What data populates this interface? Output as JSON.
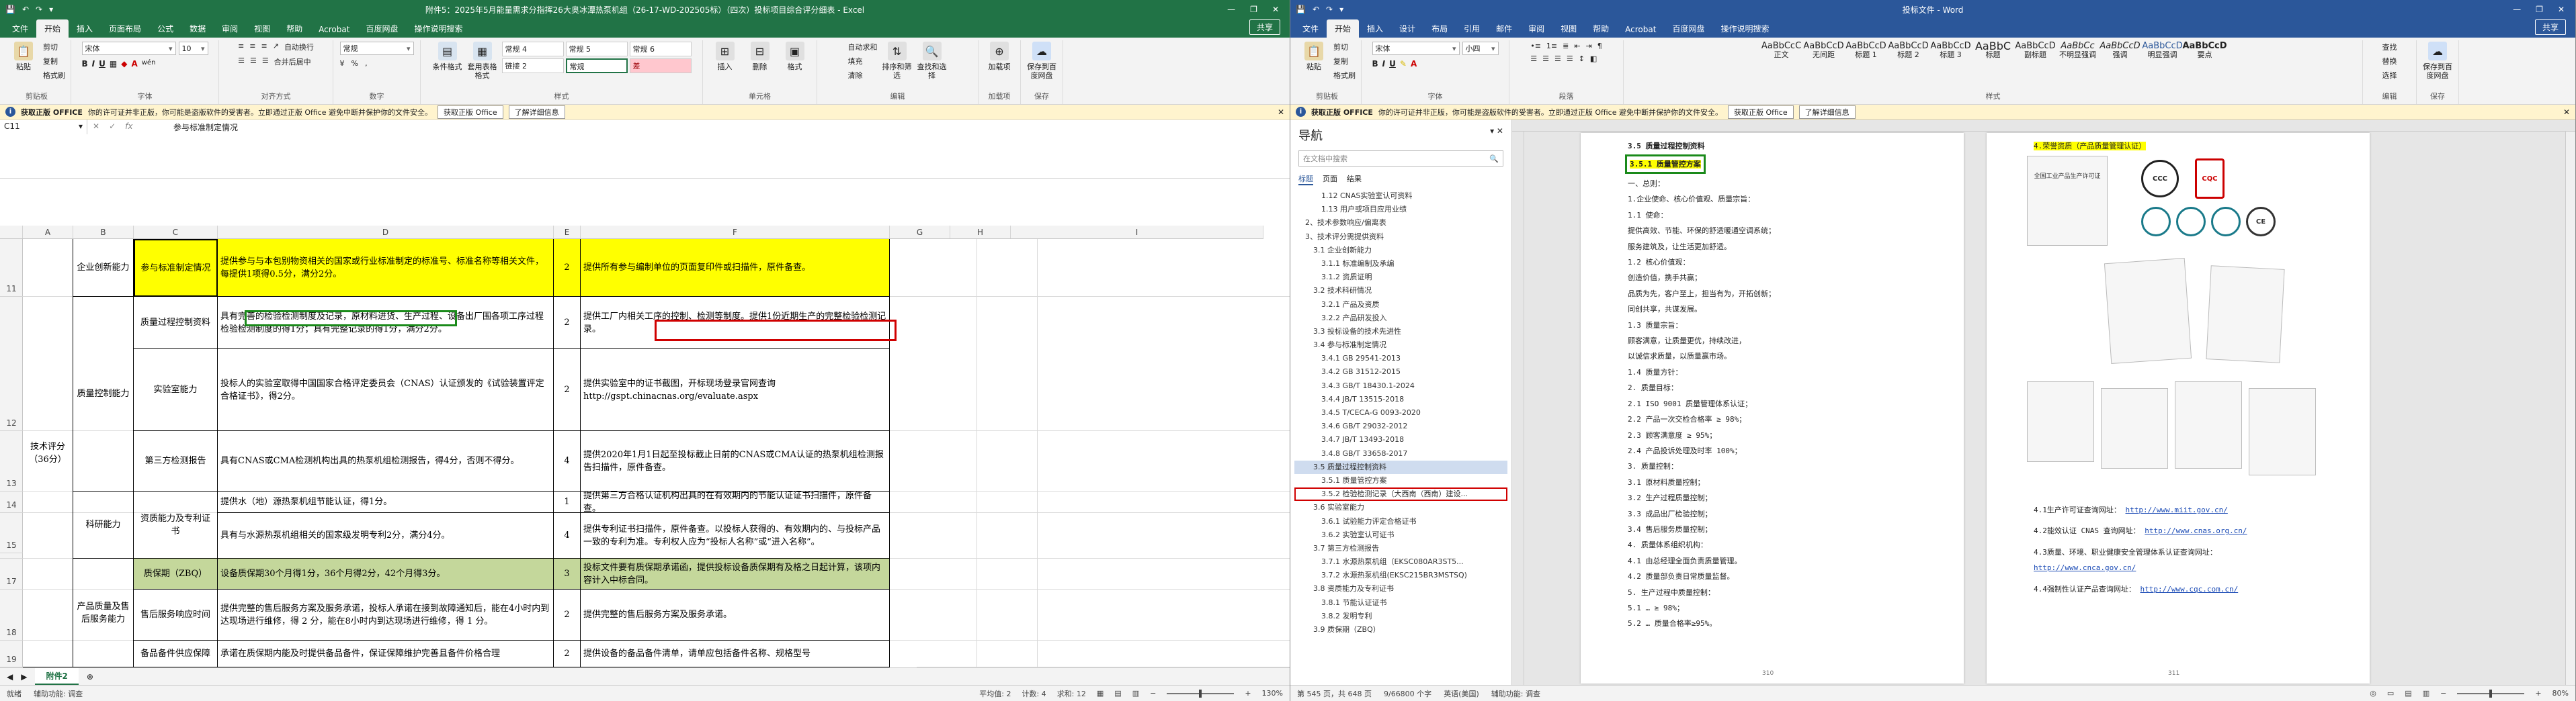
{
  "excel": {
    "title": "附件5：2025年5月能量需求分指挥26大奥冰潭热泵机组（26-17-WD-202505标）（四次）投标项目综合评分细表 - Excel",
    "qat": [
      "💾",
      "↶",
      "↷",
      "▾"
    ],
    "window_buttons": [
      "—",
      "❐",
      "✕"
    ],
    "tabs": [
      "文件",
      "开始",
      "插入",
      "页面布局",
      "公式",
      "数据",
      "审阅",
      "视图",
      "帮助",
      "Acrobat",
      "百度网盘",
      "操作说明搜索"
    ],
    "share": "共享",
    "ribbon": {
      "clipboard": {
        "paste": "粘贴",
        "cut": "剪切",
        "copy": "复制",
        "format_painter": "格式刷",
        "group": "剪贴板"
      },
      "font": {
        "name": "宋体",
        "size": "10",
        "bold": "B",
        "italic": "I",
        "underline": "U",
        "font_color_label": "A",
        "wen": "wén",
        "group": "字体"
      },
      "alignment": {
        "wrap": "自动换行",
        "merge": "合并后居中",
        "group": "对齐方式"
      },
      "number": {
        "format": "常规",
        "percent": "%",
        "comma": "‚",
        "group": "数字"
      },
      "styles": {
        "cond": "条件格式",
        "table": "套用表格格式",
        "cells": [
          "常规 4",
          "常规 5",
          "常规 6",
          "链接 2",
          "常规",
          "差"
        ],
        "group": "样式"
      },
      "cells": {
        "insert": "插入",
        "delete": "删除",
        "format": "格式",
        "group": "单元格"
      },
      "editing": {
        "autosum": "自动求和",
        "fill": "填充",
        "clear": "清除",
        "sort": "排序和筛选",
        "find": "查找和选择",
        "group": "编辑"
      },
      "addins": {
        "label": "加载项",
        "group": "加载项"
      },
      "baidu": {
        "label": "保存到百度网盘",
        "group": "保存"
      }
    },
    "infobar": {
      "badge": "获取正版 OFFICE",
      "text": "你的许可证并非正版，你可能是盗版软件的受害者。立即通过正版 Office 避免中断并保护你的文件安全。",
      "btn1": "获取正版 Office",
      "btn2": "了解详细信息"
    },
    "name_box": "C11",
    "formula_text": "参与标准制定情况",
    "columns": [
      "A",
      "B",
      "C",
      "D",
      "E",
      "F",
      "G",
      "H",
      "I"
    ],
    "rows": [
      "11",
      "12",
      "13",
      "14",
      "15",
      "16",
      "17",
      "18",
      "19"
    ],
    "cells": {
      "tech_score": "技术评分（36分）",
      "innovation": "企业创新能力",
      "quality": "质量控制能力",
      "research": "科研能力",
      "aftersales": "产品质量及售后服务能力",
      "c11": "参与标准制定情况",
      "c12a": "质量过程控制资料",
      "c12b": "实验室能力",
      "c13": "第三方检测报告",
      "c15": "资质能力及专利证书",
      "c17": "质保期（ZBQ）",
      "c18": "售后服务响应时间",
      "c19": "备品备件供应保障",
      "d11": "提供参与与本包别物资相关的国家或行业标准制定的标准号、标准名称等相关文件，每提供1项得0.5分，满分2分。",
      "d12a": "具有完善的检验检测制度及记录，原材料进货、生产过程、设备出厂围各项工序过程检验检测制度的得1分；具有完整记录的得1分，满分2分。",
      "d12b": "投标人的实验室取得中国国家合格评定委员会（CNAS）认证颁发的《试验装置评定合格证书》，得2分。",
      "d13": "具有CNAS或CMA检测机构出具的热泵机组检测报告，得4分，否则不得分。",
      "d14": "提供水（地）源热泵机组节能认证，得1分。",
      "d15": "具有与水源热泵机组相关的国家级发明专利2分，满分4分。",
      "d17": "设备质保期30个月得1分，36个月得2分，42个月得3分。",
      "d18": "提供完整的售后服务方案及服务承诺，投标人承诺在接到故障通知后，能在4小时内到达现场进行维修，得 2 分，能在8小时内到达现场进行维修，得 1 分。",
      "d19": "承诺在质保期内能及时提供备品备件，保证保障维护完善且备件价格合理",
      "e": [
        "2",
        "2",
        "2",
        "4",
        "1",
        "4",
        "3",
        "2",
        "2"
      ],
      "f11": "提供所有参与编制单位的页面复印件或扫描件，原件备查。",
      "f12a": "提供工厂内相关工序的控制、检测等制度。提供1份近期生产的完整检验检测记录。",
      "f12b": "提供实验室中的证书截图，开标现场登录官网查询 http://gspt.chinacnas.org/evaluate.aspx",
      "f13": "提供2020年1月1日起至投标截止日前的CNAS或CMA认证的热泵机组检测报告扫描件，原件备查。",
      "f14": "提供第三方合格认证机构出具的在有效期内的节能认证证书扫描件，原件备查。",
      "f15": "提供专利证书扫描件，原件备查。以投标人获得的、有效期内的、与投标产品一致的专利为准。专利权人应为“投标人名称”或“进入名称”。",
      "f17": "投标文件要有质保期承诺函，提供投标设备质保期有及格之日起计算，该项内容计入中标合同。",
      "f18": "提供完整的售后服务方案及服务承诺。",
      "f19": "提供设备的备品备件清单，请单应包括备件名称、规格型号"
    },
    "sheet_tab": "附件2",
    "status": {
      "mode": "就绪",
      "accessibility": "辅助功能: 调查",
      "avg": "平均值: 2",
      "count": "计数: 4",
      "sum": "求和: 12",
      "zoom": "130%"
    }
  },
  "word": {
    "title": "投标文件 - Word",
    "qat": [
      "💾",
      "↶",
      "↷",
      "▾"
    ],
    "window_buttons": [
      "—",
      "❐",
      "✕"
    ],
    "tabs": [
      "文件",
      "开始",
      "插入",
      "设计",
      "布局",
      "引用",
      "邮件",
      "审阅",
      "视图",
      "帮助",
      "Acrobat",
      "百度网盘",
      "操作说明搜索"
    ],
    "share": "共享",
    "ribbon": {
      "font": {
        "name": "宋体",
        "size": "小四",
        "group": "字体"
      },
      "paragraph_group": "段落",
      "styles": [
        "AaBbCcC",
        "AaBbCcD",
        "AaBbCcD",
        "AaBbCcD",
        "AaBbCcD",
        "AaBbC",
        "AaBbCcD",
        "AaBbCc",
        "AaBbCcD",
        "AaBbCcD",
        "AaBbCcD"
      ],
      "style_names": [
        "正文",
        "无间距",
        "标题 1",
        "标题 2",
        "标题 3",
        "标题",
        "副标题",
        "不明显强调",
        "强调",
        "明显强调",
        "要点"
      ],
      "styles_group": "样式",
      "editing": {
        "find": "查找",
        "replace": "替换",
        "select": "选择",
        "group": "编辑"
      },
      "baidu": {
        "label": "保存到百度网盘",
        "group": "保存"
      }
    },
    "infobar": {
      "badge": "获取正版 OFFICE",
      "text": "你的许可证并非正版，你可能是盗版软件的受害者。立即通过正版 Office 避免中断并保护你的文件安全。",
      "btn1": "获取正版 Office",
      "btn2": "了解详细信息"
    },
    "nav": {
      "title": "导航",
      "search_placeholder": "在文档中搜索",
      "tabs": [
        "标题",
        "页面",
        "结果"
      ],
      "items": [
        "1.12 CNAS实验室认可资料",
        "1.13 用户或项目应用业绩",
        "2、技术参数响应/偏离表",
        "3、技术评分需提供资料",
        "3.1 企业创新能力",
        "3.1.1 标准编制及承编",
        "3.1.2 资质证明",
        "3.2 技术科研情况",
        "3.2.1 产品及资质",
        "3.2.2 产品研发投入",
        "3.3 投标设备的技术先进性",
        "3.4 参与标准制定情况",
        "3.4.1 GB 29541-2013",
        "3.4.2 GB 31512-2015",
        "3.4.3 GB/T 18430.1-2024",
        "3.4.4 JB/T 13515-2018",
        "3.4.5 T/CECA-G 0093-2020",
        "3.4.6 GB/T 29032-2012",
        "3.4.7 JB/T 13493-2018",
        "3.4.8 GB/T 33658-2017",
        "3.5 质量过程控制资料",
        "3.5.1 质量管控方案",
        "3.5.2 检验检测记录（大西南（西南）建设...",
        "3.6 实验室能力",
        "3.6.1 试验能力评定合格证书",
        "3.6.2 实验室认可证书",
        "3.7 第三方检测报告",
        "3.7.1 水源热泵机组（EKSC080AR3ST5...",
        "3.7.2 水源热泵机组(EKSC215BR3MSTSQ)",
        "3.8 资质能力及专利证书",
        "3.8.1 节能认证证书",
        "3.8.2 发明专利",
        "3.9 质保期（ZBQ）"
      ]
    },
    "doc_left": {
      "heading1": "3.5 质量过程控制资料",
      "heading2": "3.5.1 质量管控方案",
      "lines": [
        "一、总则：",
        "1.企业使命、核心价值观、质量宗旨：",
        "1.1 使命：",
        "提供高效、节能、环保的舒适暖通空调系统；",
        "服务建筑及，让生活更加舒适。",
        "1.2 核心价值观：",
        "创造价值，携手共赢；",
        "品质为先，客户至上，担当有为，开拓创新；",
        "同创共享，共谋发展。",
        "1.3 质量宗旨：",
        "顾客满意，让质量更优，持续改进，",
        "以诚信求质量，以质量赢市场。",
        "1.4 质量方针：",
        "2. 质量目标：",
        "2.1 ISO 9001 质量管理体系认证；",
        "2.2 产品一次交检合格率 ≥ 98%；",
        "2.3 顾客满意度 ≥ 95%；",
        "2.4 产品投诉处理及时率 100%；",
        "3. 质量控制：",
        "3.1 原材料质量控制；",
        "3.2 生产过程质量控制；",
        "3.3 成品出厂检验控制；",
        "3.4 售后服务质量控制；",
        "4. 质量体系组织机构：",
        "4.1 由总经理全面负责质量管理。",
        "4.2 质量部负责日常质量监督。",
        "5. 生产过程中质量控制：",
        "5.1 … ≥ 98%；",
        "5.2 … 质量合格率≥95%。"
      ],
      "page_num": "310"
    },
    "doc_right": {
      "heading": "4.荣誉资质（产品质量管理认证）",
      "cert_labels": [
        "全国工业产品生产许可证",
        "CCC",
        "CQC",
        "CE"
      ],
      "links": [
        "4.1生产许可证查询网址：",
        "4.2能效认证 CNAS 查询网址：",
        "4.3质量、环境、职业健康安全管理体系认证查询网址：",
        "4.4强制性认证产品查询网址："
      ],
      "link_urls": [
        "http://www.miit.gov.cn/",
        "http://www.cnas.org.cn/",
        "http://www.cnca.gov.cn/",
        "http://www.cqc.com.cn/"
      ],
      "page_num": "311"
    },
    "status": {
      "page": "第 545 页，共 648 页",
      "words": "9/66800 个字",
      "lang": "英语(美国)",
      "accessibility": "辅助功能: 调查",
      "zoom": "80%"
    }
  },
  "colors": {
    "excel_green": "#217346",
    "word_blue": "#2b579a",
    "highlight_yellow": "#ffff00",
    "cell_green": "#c4d79b",
    "red_box": "#d00000",
    "green_box": "#1a8a1a"
  }
}
